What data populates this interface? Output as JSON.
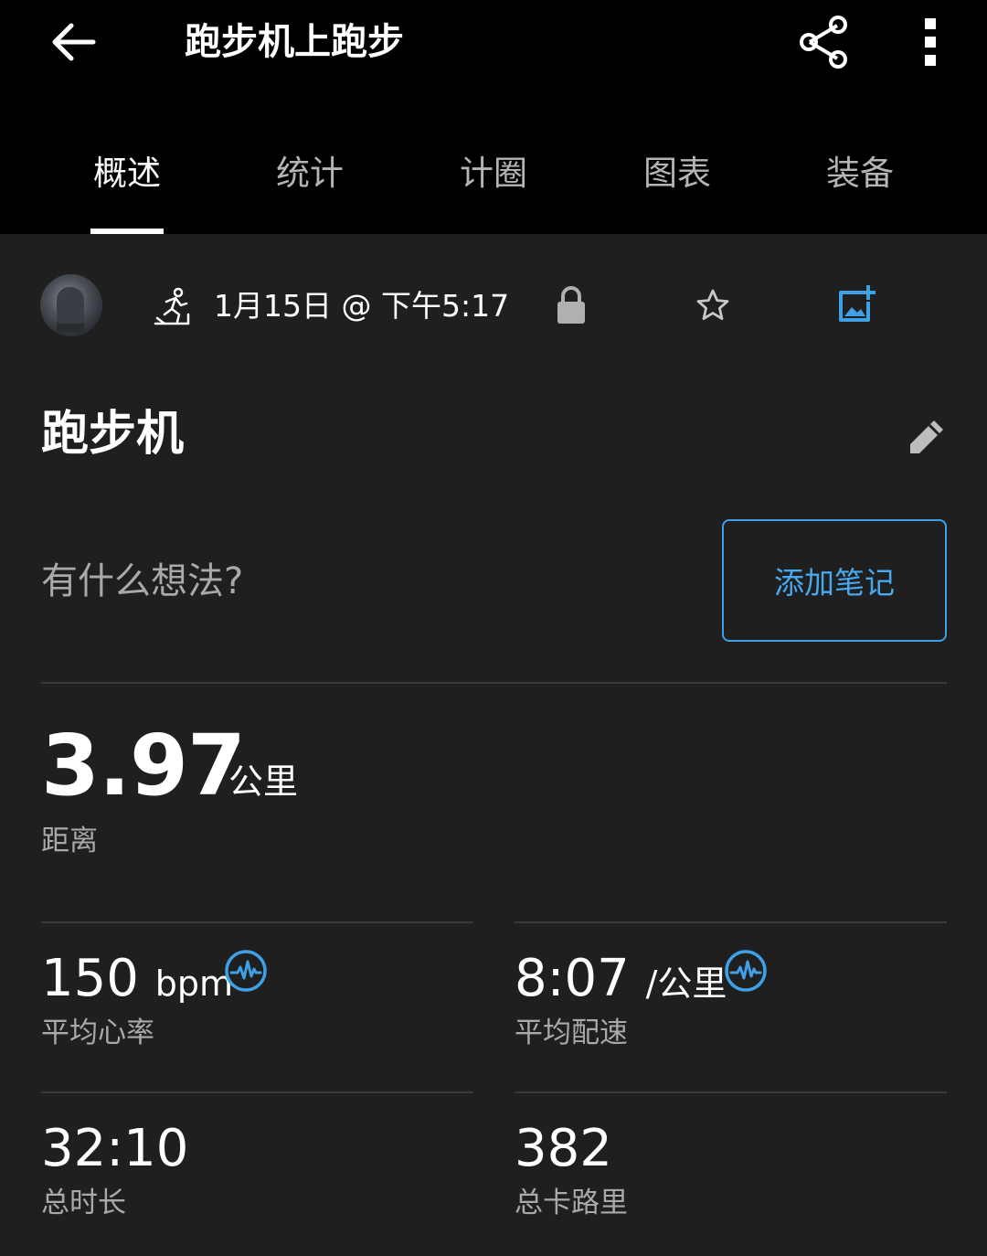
{
  "header": {
    "title": "跑步机上跑步",
    "back_icon": "arrow-left-icon",
    "share_icon": "share-icon",
    "more_icon": "more-vert-icon"
  },
  "tabs": [
    {
      "label": "概述",
      "active": true
    },
    {
      "label": "统计",
      "active": false
    },
    {
      "label": "计圈",
      "active": false
    },
    {
      "label": "图表",
      "active": false
    },
    {
      "label": "装备",
      "active": false
    }
  ],
  "activity": {
    "date": "1月15日 @ 下午5:17",
    "type_icon": "treadmill-run-icon",
    "name": "跑步机",
    "notes_prompt": "有什么想法?",
    "add_note_label": "添加笔记"
  },
  "distance": {
    "value": "3.97",
    "unit": "公里",
    "label": "距离"
  },
  "stats": [
    {
      "value": "150",
      "unit": "bpm",
      "label": "平均心率",
      "has_hr_icon": true
    },
    {
      "value": "8:07",
      "unit": "/公里",
      "label": "平均配速",
      "has_hr_icon": true
    },
    {
      "value": "32:10",
      "unit": "",
      "label": "总时长",
      "has_hr_icon": false
    },
    {
      "value": "382",
      "unit": "",
      "label": "总卡路里",
      "has_hr_icon": false
    }
  ],
  "colors": {
    "header_bg": "#000000",
    "body_bg": "#1f1f1f",
    "accent": "#3fa0e6"
  }
}
